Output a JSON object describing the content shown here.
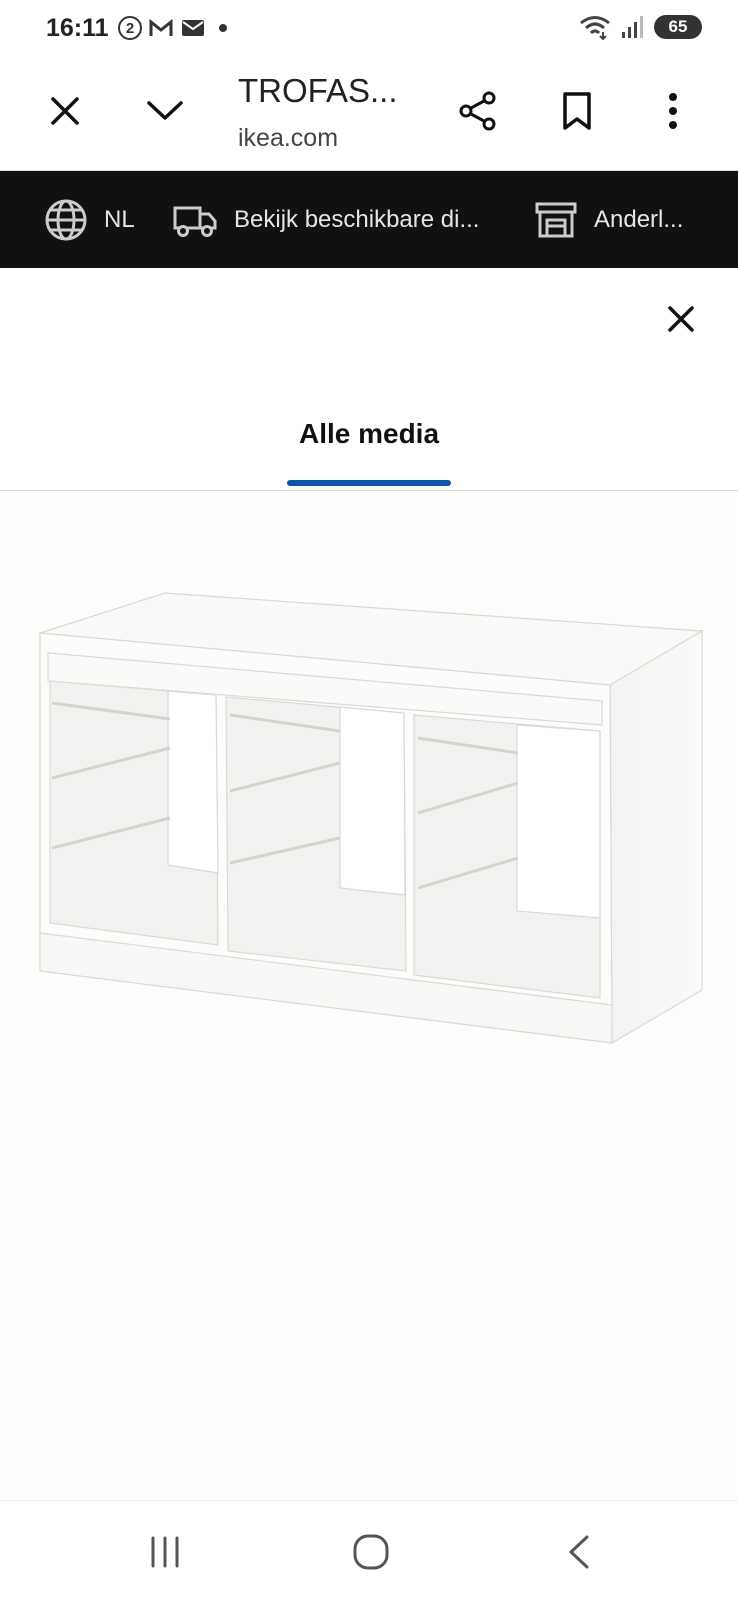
{
  "status_bar": {
    "time": "16:11",
    "notification_count": "2",
    "battery": "65",
    "icons": [
      "notification-count-icon",
      "gmail-icon",
      "mail-icon",
      "dot-icon",
      "wifi-icon",
      "signal-icon"
    ]
  },
  "browser": {
    "title": "TROFAS...",
    "domain": "ikea.com",
    "buttons": [
      "close-icon",
      "chevron-down-icon",
      "share-icon",
      "bookmark-icon",
      "more-vert-icon"
    ]
  },
  "banner": {
    "language": "NL",
    "delivery": "Bekijk beschikbare di...",
    "store": "Anderl..."
  },
  "modal": {
    "tab_label": "Alle media",
    "image_subject": "TROFAST white storage frame with three compartments"
  },
  "colors": {
    "accent": "#0a58a6",
    "banner_bg": "#111111",
    "image_bg": "#fdfdfc"
  }
}
